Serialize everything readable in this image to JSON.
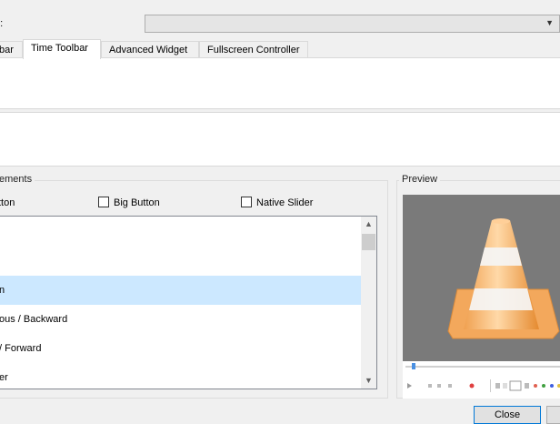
{
  "profile": {
    "label": "e:",
    "value": ""
  },
  "tabs": [
    {
      "label": "bar",
      "active": false
    },
    {
      "label": "Time Toolbar",
      "active": true
    },
    {
      "label": "Advanced Widget",
      "active": false
    },
    {
      "label": "Fullscreen Controller",
      "active": false
    }
  ],
  "elements_group": {
    "title": "ements",
    "options": {
      "button": "tton",
      "big_button": "Big Button",
      "native_slider": "Native Slider"
    },
    "items": [
      {
        "label": "",
        "selected": false
      },
      {
        "label": "n",
        "selected": true
      },
      {
        "label": "ous / Backward",
        "selected": false
      },
      {
        "label": "/ Forward",
        "selected": false
      },
      {
        "label": "er",
        "selected": false
      }
    ]
  },
  "preview": {
    "title": "Preview"
  },
  "buttons": {
    "close": "Close"
  },
  "colors": {
    "accent": "#0078d7",
    "selection": "#cce8ff",
    "cone_orange": "#f5a54a"
  }
}
